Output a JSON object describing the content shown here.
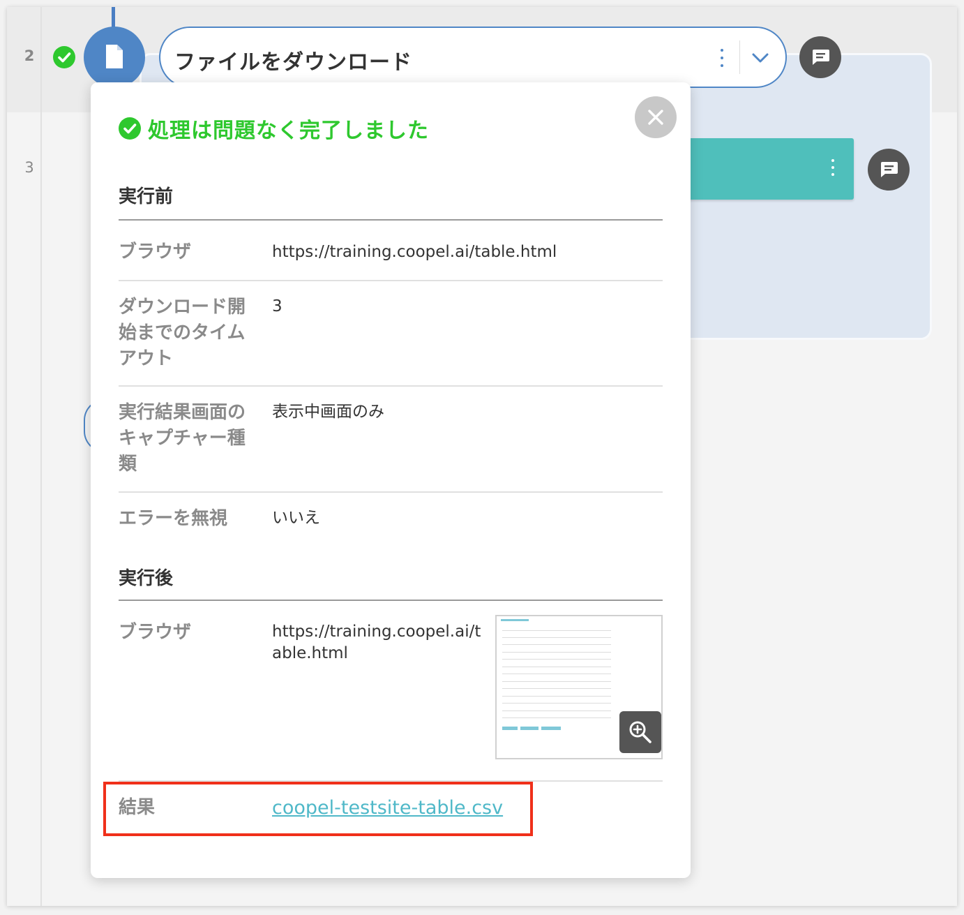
{
  "flow": {
    "rows": [
      {
        "line_number": "2",
        "status_icon": "check-circle-icon"
      },
      {
        "line_number": "3"
      }
    ],
    "step": {
      "title": "ファイルをダウンロード",
      "icon": "file-icon",
      "menu_icon": "kebab-icon",
      "expand_icon": "chevron-down-icon",
      "accent_color": "#4f86c6"
    },
    "comment_icon": "comment-icon",
    "teal_block_color": "#4fbfbb"
  },
  "popover": {
    "status_text": "処理は問題なく完了しました",
    "status_color": "#2ec82e",
    "close_icon": "close-icon",
    "before": {
      "heading": "実行前",
      "rows": [
        {
          "key": "ブラウザ",
          "value": "https://training.coopel.ai/table.html"
        },
        {
          "key": "ダウンロード開始までのタイムアウト",
          "value": "3"
        },
        {
          "key": "実行結果画面のキャプチャー種類",
          "value": "表示中画面のみ"
        },
        {
          "key": "エラーを無視",
          "value": "いいえ"
        }
      ]
    },
    "after": {
      "heading": "実行後",
      "browser_key": "ブラウザ",
      "browser_value": "https://training.coopel.ai/table.html",
      "zoom_icon": "zoom-in-icon",
      "result_key": "結果",
      "result_link": "coopel-testsite-table.csv",
      "highlight_color": "#f0301a"
    }
  }
}
